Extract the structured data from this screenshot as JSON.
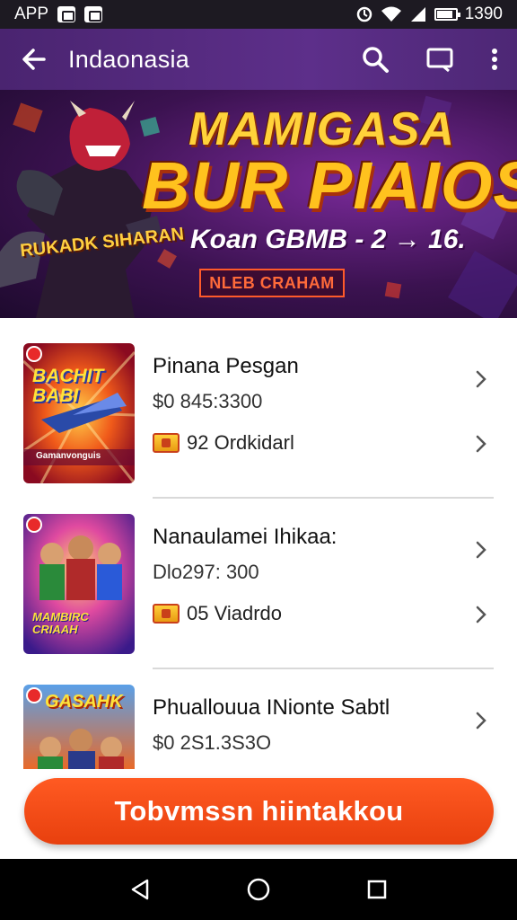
{
  "status_bar": {
    "left_label": "APP",
    "time": "1390",
    "battery_level": 0.85
  },
  "app_bar": {
    "title": "Indaonasia"
  },
  "banner": {
    "title_line1": "MAMIGASA",
    "title_line2": "BUR PIAIOS",
    "subtitle": "Koan GBMB - 2 → 16.",
    "button_label": "NLEB CRAHAM",
    "badge_text": "RUKADK SIHARAN"
  },
  "items": [
    {
      "title": "Pinana Pesgan",
      "price": "$0 845:3300",
      "badge": "92 Ordkidarl",
      "thumb_text": "BACHIT BABI",
      "thumb_subtext": "Gamanvonguis"
    },
    {
      "title": "Nanaulamei Ihikaa:",
      "price": "Dlo297: 300",
      "badge": "05 Viadrdo",
      "thumb_text": "MAMBIRC CRIAAH",
      "thumb_subtext": ""
    },
    {
      "title": "Phuallouua INionte Sabtl",
      "price": "$0 2S1.3S3O",
      "badge": "",
      "thumb_text": "GASAHK",
      "thumb_subtext": ""
    }
  ],
  "cta": {
    "label": "Tobvmssn hiintakkou"
  },
  "colors": {
    "app_bar": "#5d2f8a",
    "cta": "#f04a16",
    "banner_gold": "#ffc21e"
  },
  "icons": {
    "back": "arrow-left-icon",
    "search": "search-icon",
    "cast": "cast-icon",
    "more": "more-vert-icon",
    "chevron": "chevron-right-icon",
    "coin": "coin-icon",
    "nav_back": "nav-back-icon",
    "nav_home": "nav-home-icon",
    "nav_recent": "nav-recents-icon"
  }
}
